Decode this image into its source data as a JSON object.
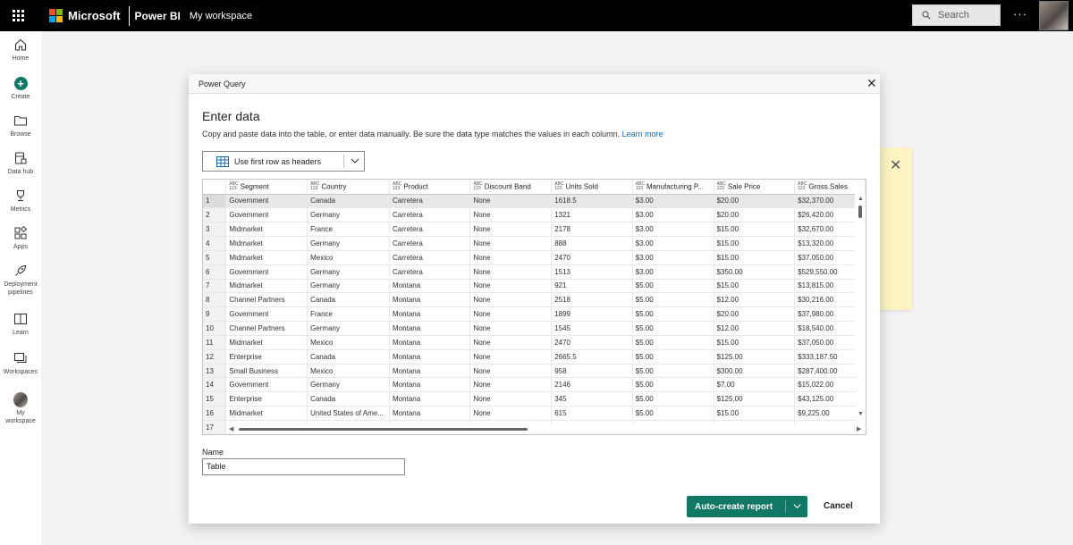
{
  "topbar": {
    "brand": "Microsoft",
    "app": "Power BI",
    "workspace": "My workspace",
    "search_placeholder": "Search",
    "more": "···",
    "ms_colors": [
      "#f25022",
      "#7fba00",
      "#00a4ef",
      "#ffb900"
    ]
  },
  "nav": [
    {
      "label": "Home",
      "icon": "home-icon"
    },
    {
      "label": "Create",
      "icon": "plus-icon"
    },
    {
      "label": "Browse",
      "icon": "folder-icon"
    },
    {
      "label": "Data hub",
      "icon": "database-icon"
    },
    {
      "label": "Metrics",
      "icon": "trophy-icon"
    },
    {
      "label": "Apps",
      "icon": "apps-icon"
    },
    {
      "label": "Deployment pipelines",
      "icon": "rocket-icon"
    },
    {
      "label": "Learn",
      "icon": "book-icon"
    },
    {
      "label": "Workspaces",
      "icon": "workspaces-icon"
    },
    {
      "label": "My workspace",
      "icon": "avatar-icon"
    }
  ],
  "dialog": {
    "title": "Power Query",
    "heading": "Enter data",
    "description": "Copy and paste data into the table, or enter data manually. Be sure the data type matches the values in each column.",
    "learn_more": "Learn more",
    "header_toggle": "Use first row as headers",
    "name_label": "Name",
    "name_value": "Table",
    "primary_button": "Auto-create report",
    "cancel_button": "Cancel",
    "accent": "#117865"
  },
  "table": {
    "type_icon_top": "ABC",
    "type_icon_bottom": "123",
    "columns": [
      "Segment",
      "Country",
      "Product",
      "Discount Band",
      "Units Sold",
      "Manufacturing P...",
      "Sale Price",
      "Gross Sales"
    ],
    "rows": [
      [
        "Government",
        "Canada",
        "Carretera",
        "None",
        "1618.5",
        "$3.00",
        "$20.00",
        "$32,370.00"
      ],
      [
        "Government",
        "Germany",
        "Carretera",
        "None",
        "1321",
        "$3.00",
        "$20.00",
        "$26,420.00"
      ],
      [
        "Midmarket",
        "France",
        "Carretera",
        "None",
        "2178",
        "$3.00",
        "$15.00",
        "$32,670.00"
      ],
      [
        "Midmarket",
        "Germany",
        "Carretera",
        "None",
        "888",
        "$3.00",
        "$15.00",
        "$13,320.00"
      ],
      [
        "Midmarket",
        "Mexico",
        "Carretera",
        "None",
        "2470",
        "$3.00",
        "$15.00",
        "$37,050.00"
      ],
      [
        "Government",
        "Germany",
        "Carretera",
        "None",
        "1513",
        "$3.00",
        "$350.00",
        "$529,550.00"
      ],
      [
        "Midmarket",
        "Germany",
        "Montana",
        "None",
        "921",
        "$5.00",
        "$15.00",
        "$13,815.00"
      ],
      [
        "Channel Partners",
        "Canada",
        "Montana",
        "None",
        "2518",
        "$5.00",
        "$12.00",
        "$30,216.00"
      ],
      [
        "Government",
        "France",
        "Montana",
        "None",
        "1899",
        "$5.00",
        "$20.00",
        "$37,980.00"
      ],
      [
        "Channel Partners",
        "Germany",
        "Montana",
        "None",
        "1545",
        "$5.00",
        "$12.00",
        "$18,540.00"
      ],
      [
        "Midmarket",
        "Mexico",
        "Montana",
        "None",
        "2470",
        "$5.00",
        "$15.00",
        "$37,050.00"
      ],
      [
        "Enterprise",
        "Canada",
        "Montana",
        "None",
        "2665.5",
        "$5.00",
        "$125.00",
        "$333,187.50"
      ],
      [
        "Small Business",
        "Mexico",
        "Montana",
        "None",
        "958",
        "$5.00",
        "$300.00",
        "$287,400.00"
      ],
      [
        "Government",
        "Germany",
        "Montana",
        "None",
        "2146",
        "$5.00",
        "$7.00",
        "$15,022.00"
      ],
      [
        "Enterprise",
        "Canada",
        "Montana",
        "None",
        "345",
        "$5.00",
        "$125.00",
        "$43,125.00"
      ],
      [
        "Midmarket",
        "United States of Ame...",
        "Montana",
        "None",
        "615",
        "$5.00",
        "$15.00",
        "$9,225.00"
      ],
      [
        "",
        "",
        "",
        "",
        "",
        "",
        "",
        ""
      ]
    ]
  }
}
